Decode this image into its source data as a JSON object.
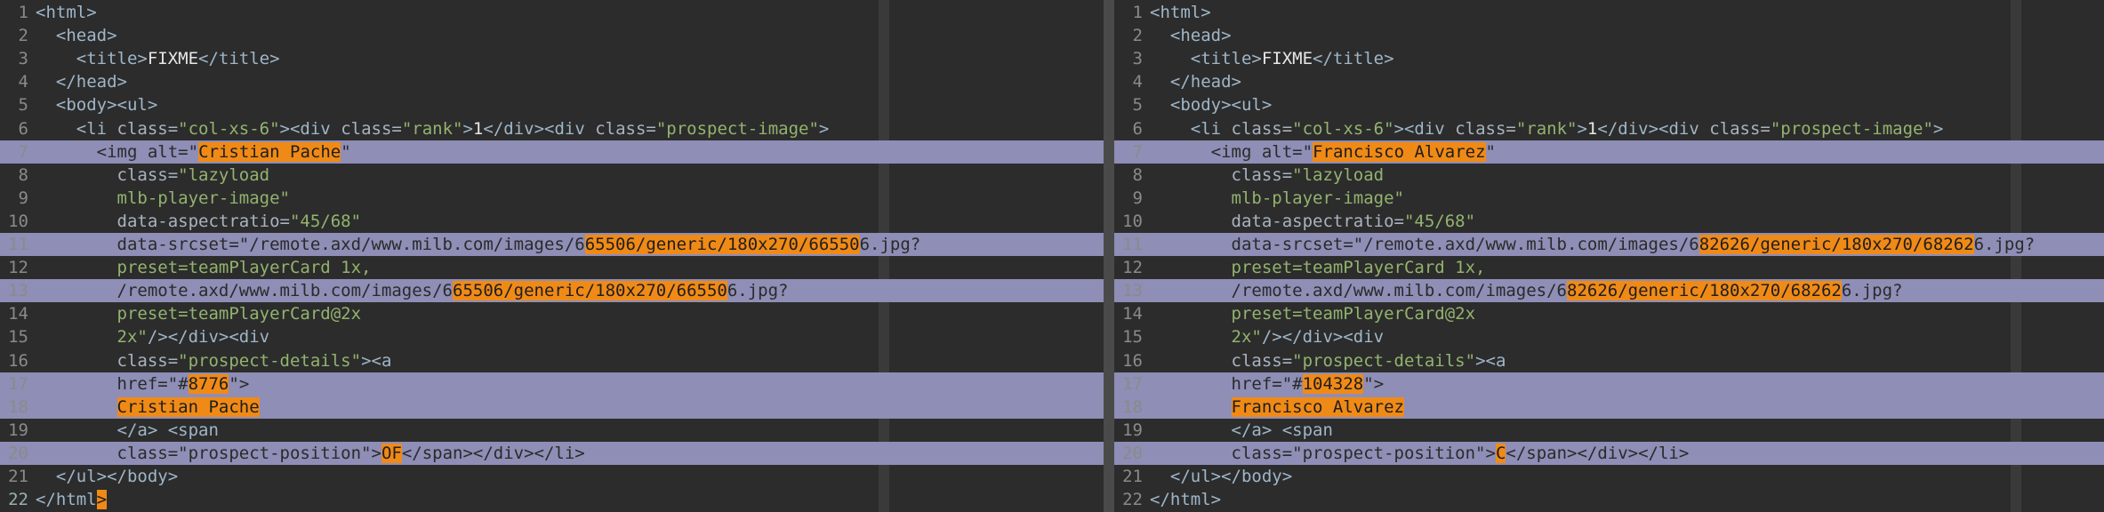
{
  "left": {
    "lines": [
      {
        "n": "1",
        "kind": "normal",
        "segs": [
          [
            "tag",
            "<html>"
          ]
        ]
      },
      {
        "n": "2",
        "kind": "normal",
        "segs": [
          [
            "tag",
            "  <head>"
          ]
        ]
      },
      {
        "n": "3",
        "kind": "normal",
        "segs": [
          [
            "tag",
            "    <title>"
          ],
          [
            "text",
            "FIXME"
          ],
          [
            "tag",
            "</title>"
          ]
        ]
      },
      {
        "n": "4",
        "kind": "normal",
        "segs": [
          [
            "tag",
            "  </head>"
          ]
        ]
      },
      {
        "n": "5",
        "kind": "normal",
        "segs": [
          [
            "tag",
            "  <body><ul>"
          ]
        ]
      },
      {
        "n": "6",
        "kind": "normal",
        "segs": [
          [
            "tag",
            "    <li "
          ],
          [
            "attr",
            "class="
          ],
          [
            "str",
            "\"col-xs-6\""
          ],
          [
            "tag",
            "><div "
          ],
          [
            "attr",
            "class="
          ],
          [
            "str",
            "\"rank\""
          ],
          [
            "tag",
            ">"
          ],
          [
            "text",
            "1"
          ],
          [
            "tag",
            "</div><div "
          ],
          [
            "attr",
            "class="
          ],
          [
            "str",
            "\"prospect-image\""
          ],
          [
            "tag",
            ">"
          ]
        ]
      },
      {
        "n": "7",
        "kind": "changed",
        "segs": [
          [
            "tag",
            "      <img "
          ],
          [
            "attr",
            "alt="
          ],
          [
            "str",
            "\""
          ],
          [
            "hl",
            "Cristian Pache"
          ],
          [
            "str",
            "\""
          ]
        ]
      },
      {
        "n": "8",
        "kind": "normal",
        "segs": [
          [
            "attr",
            "        class="
          ],
          [
            "str",
            "\"lazyload"
          ]
        ]
      },
      {
        "n": "9",
        "kind": "normal",
        "segs": [
          [
            "str",
            "        mlb-player-image\""
          ]
        ]
      },
      {
        "n": "10",
        "kind": "normal",
        "segs": [
          [
            "attr",
            "        data-aspectratio="
          ],
          [
            "str",
            "\"45/68\""
          ]
        ]
      },
      {
        "n": "11",
        "kind": "changed",
        "segs": [
          [
            "attr",
            "        data-srcset="
          ],
          [
            "str",
            "\"/remote.axd/www.milb.com/images/6"
          ],
          [
            "hl",
            "65506/generic/180x270/66550"
          ],
          [
            "str",
            "6.jpg?"
          ]
        ]
      },
      {
        "n": "12",
        "kind": "normal",
        "segs": [
          [
            "str",
            "        preset=teamPlayerCard 1x,"
          ]
        ]
      },
      {
        "n": "13",
        "kind": "changed",
        "segs": [
          [
            "str",
            "        /remote.axd/www.milb.com/images/6"
          ],
          [
            "hl",
            "65506/generic/180x270/66550"
          ],
          [
            "str",
            "6.jpg?"
          ]
        ]
      },
      {
        "n": "14",
        "kind": "normal",
        "segs": [
          [
            "str",
            "        preset=teamPlayerCard@2x"
          ]
        ]
      },
      {
        "n": "15",
        "kind": "normal",
        "segs": [
          [
            "str",
            "        2x\""
          ],
          [
            "tag",
            "/></div><div"
          ]
        ]
      },
      {
        "n": "16",
        "kind": "normal",
        "segs": [
          [
            "attr",
            "        class="
          ],
          [
            "str",
            "\"prospect-details\""
          ],
          [
            "tag",
            "><a"
          ]
        ]
      },
      {
        "n": "17",
        "kind": "changed",
        "segs": [
          [
            "attr",
            "        href="
          ],
          [
            "str",
            "\"#"
          ],
          [
            "hl",
            "8776"
          ],
          [
            "str",
            "\""
          ],
          [
            "tag",
            ">"
          ]
        ]
      },
      {
        "n": "18",
        "kind": "changed",
        "segs": [
          [
            "text",
            "        "
          ],
          [
            "hl",
            "Cristian Pache"
          ]
        ]
      },
      {
        "n": "19",
        "kind": "normal",
        "segs": [
          [
            "tag",
            "        </a> <span"
          ]
        ]
      },
      {
        "n": "20",
        "kind": "changed",
        "segs": [
          [
            "attr",
            "        class="
          ],
          [
            "str",
            "\"prospect-position\""
          ],
          [
            "tag",
            ">"
          ],
          [
            "hl",
            "OF"
          ],
          [
            "tag",
            "</span></div></li>"
          ]
        ]
      },
      {
        "n": "21",
        "kind": "normal",
        "segs": [
          [
            "tag",
            "  </ul></body>"
          ]
        ]
      },
      {
        "n": "22",
        "kind": "current",
        "segs": [
          [
            "tag",
            "</html"
          ],
          [
            "cursor",
            ">"
          ]
        ]
      }
    ]
  },
  "right": {
    "lines": [
      {
        "n": "1",
        "kind": "normal",
        "segs": [
          [
            "tag",
            "<html>"
          ]
        ]
      },
      {
        "n": "2",
        "kind": "normal",
        "segs": [
          [
            "tag",
            "  <head>"
          ]
        ]
      },
      {
        "n": "3",
        "kind": "normal",
        "segs": [
          [
            "tag",
            "    <title>"
          ],
          [
            "text",
            "FIXME"
          ],
          [
            "tag",
            "</title>"
          ]
        ]
      },
      {
        "n": "4",
        "kind": "normal",
        "segs": [
          [
            "tag",
            "  </head>"
          ]
        ]
      },
      {
        "n": "5",
        "kind": "normal",
        "segs": [
          [
            "tag",
            "  <body><ul>"
          ]
        ]
      },
      {
        "n": "6",
        "kind": "normal",
        "segs": [
          [
            "tag",
            "    <li "
          ],
          [
            "attr",
            "class="
          ],
          [
            "str",
            "\"col-xs-6\""
          ],
          [
            "tag",
            "><div "
          ],
          [
            "attr",
            "class="
          ],
          [
            "str",
            "\"rank\""
          ],
          [
            "tag",
            ">"
          ],
          [
            "text",
            "1"
          ],
          [
            "tag",
            "</div><div "
          ],
          [
            "attr",
            "class="
          ],
          [
            "str",
            "\"prospect-image\""
          ],
          [
            "tag",
            ">"
          ]
        ]
      },
      {
        "n": "7",
        "kind": "changed",
        "segs": [
          [
            "tag",
            "      <img "
          ],
          [
            "attr",
            "alt="
          ],
          [
            "str",
            "\""
          ],
          [
            "hl",
            "Francisco Alvarez"
          ],
          [
            "str",
            "\""
          ]
        ]
      },
      {
        "n": "8",
        "kind": "normal",
        "segs": [
          [
            "attr",
            "        class="
          ],
          [
            "str",
            "\"lazyload"
          ]
        ]
      },
      {
        "n": "9",
        "kind": "normal",
        "segs": [
          [
            "str",
            "        mlb-player-image\""
          ]
        ]
      },
      {
        "n": "10",
        "kind": "normal",
        "segs": [
          [
            "attr",
            "        data-aspectratio="
          ],
          [
            "str",
            "\"45/68\""
          ]
        ]
      },
      {
        "n": "11",
        "kind": "changed",
        "segs": [
          [
            "attr",
            "        data-srcset="
          ],
          [
            "str",
            "\"/remote.axd/www.milb.com/images/6"
          ],
          [
            "hl",
            "82626/generic/180x270/68262"
          ],
          [
            "str",
            "6.jpg?"
          ]
        ]
      },
      {
        "n": "12",
        "kind": "normal",
        "segs": [
          [
            "str",
            "        preset=teamPlayerCard 1x,"
          ]
        ]
      },
      {
        "n": "13",
        "kind": "changed",
        "segs": [
          [
            "str",
            "        /remote.axd/www.milb.com/images/6"
          ],
          [
            "hl",
            "82626/generic/180x270/68262"
          ],
          [
            "str",
            "6.jpg?"
          ]
        ]
      },
      {
        "n": "14",
        "kind": "normal",
        "segs": [
          [
            "str",
            "        preset=teamPlayerCard@2x"
          ]
        ]
      },
      {
        "n": "15",
        "kind": "normal",
        "segs": [
          [
            "str",
            "        2x\""
          ],
          [
            "tag",
            "/></div><div"
          ]
        ]
      },
      {
        "n": "16",
        "kind": "normal",
        "segs": [
          [
            "attr",
            "        class="
          ],
          [
            "str",
            "\"prospect-details\""
          ],
          [
            "tag",
            "><a"
          ]
        ]
      },
      {
        "n": "17",
        "kind": "changed",
        "segs": [
          [
            "attr",
            "        href="
          ],
          [
            "str",
            "\"#"
          ],
          [
            "hl",
            "104328"
          ],
          [
            "str",
            "\""
          ],
          [
            "tag",
            ">"
          ]
        ]
      },
      {
        "n": "18",
        "kind": "changed",
        "segs": [
          [
            "text",
            "        "
          ],
          [
            "hl",
            "Francisco Alvarez"
          ]
        ]
      },
      {
        "n": "19",
        "kind": "normal",
        "segs": [
          [
            "tag",
            "        </a> <span"
          ]
        ]
      },
      {
        "n": "20",
        "kind": "changed",
        "segs": [
          [
            "attr",
            "        class="
          ],
          [
            "str",
            "\"prospect-position\""
          ],
          [
            "tag",
            ">"
          ],
          [
            "hl",
            "C"
          ],
          [
            "tag",
            "</span></div></li>"
          ]
        ]
      },
      {
        "n": "21",
        "kind": "normal",
        "segs": [
          [
            "tag",
            "  </ul></body>"
          ]
        ]
      },
      {
        "n": "22",
        "kind": "normal",
        "segs": [
          [
            "tag",
            "</html>"
          ]
        ]
      }
    ]
  }
}
